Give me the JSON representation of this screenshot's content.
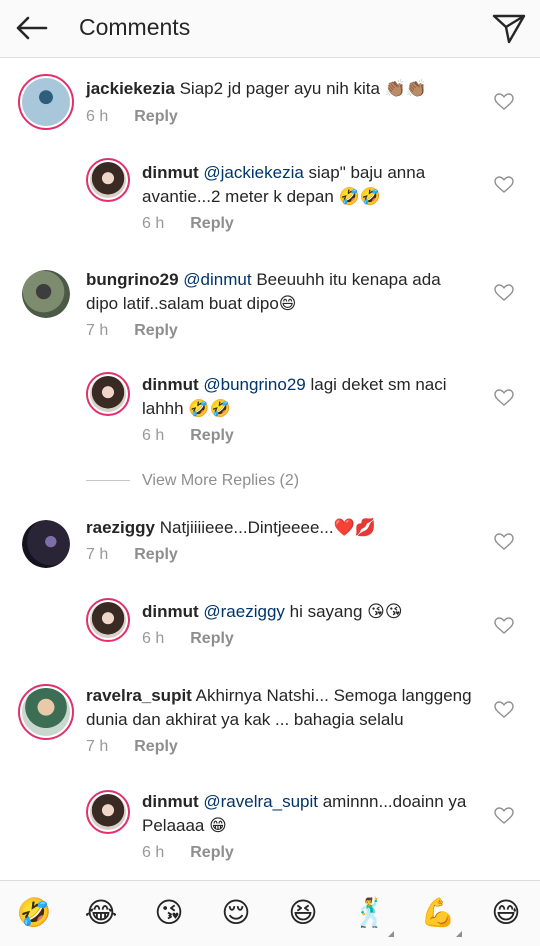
{
  "header": {
    "title": "Comments"
  },
  "comments": [
    {
      "username": "jackiekezia",
      "mention": "",
      "text": "Siap2 jd pager ayu nih kita 👏🏽👏🏽",
      "time": "6 h",
      "reply": "Reply"
    },
    {
      "username": "dinmut",
      "mention": "@jackiekezia",
      "text": "siap\" baju anna avantie...2 meter k depan 🤣🤣",
      "time": "6 h",
      "reply": "Reply"
    },
    {
      "username": "bungrino29",
      "mention": "@dinmut",
      "text": "Beeuuhh itu kenapa ada dipo latif..salam buat dipo😄",
      "time": "7 h",
      "reply": "Reply"
    },
    {
      "username": "dinmut",
      "mention": "@bungrino29",
      "text": "lagi deket sm naci lahhh 🤣🤣",
      "time": "6 h",
      "reply": "Reply"
    },
    {
      "username": "raeziggy",
      "mention": "",
      "text": "Natjiiiieee...Dintjeeee...❤️💋",
      "time": "7 h",
      "reply": "Reply"
    },
    {
      "username": "dinmut",
      "mention": "@raeziggy",
      "text": "hi sayang 😘😘",
      "time": "6 h",
      "reply": "Reply"
    },
    {
      "username": "ravelra_supit",
      "mention": "",
      "text": "Akhirnya Natshi... Semoga langgeng dunia dan akhirat ya kak ... bahagia selalu",
      "time": "7 h",
      "reply": "Reply"
    },
    {
      "username": "dinmut",
      "mention": "@ravelra_supit",
      "text": "aminnn...doainn ya Pelaaaa 😁",
      "time": "6 h",
      "reply": "Reply"
    }
  ],
  "view_more": "View More Replies (2)",
  "emoji_bar": [
    "🤣",
    "😂",
    "😘",
    "😌",
    "😆",
    "🕺",
    "💪",
    "😅"
  ],
  "colors": {
    "accent_ring": "#e1306c",
    "mention": "#003569",
    "meta": "#999999"
  }
}
